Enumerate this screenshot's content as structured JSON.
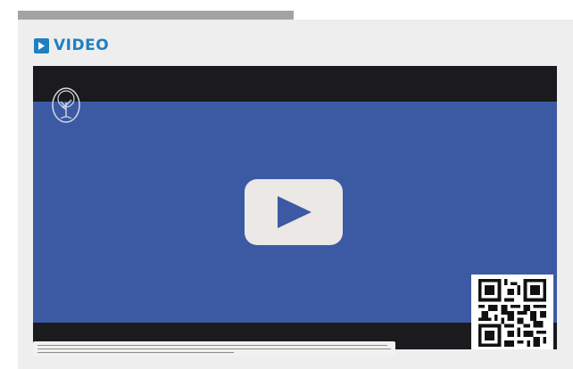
{
  "section": {
    "title": "VIDEO",
    "icon": "play-icon",
    "accent_color": "#1f7fc1"
  },
  "video": {
    "background_color": "#3c5aa4",
    "letterbox_color": "#1b1a1c",
    "logo_icon": "tree-emblem-icon",
    "play_button_icon": "play-icon",
    "qr_icon": "qr-code-icon",
    "footer_caption_icon": "caption-text"
  }
}
